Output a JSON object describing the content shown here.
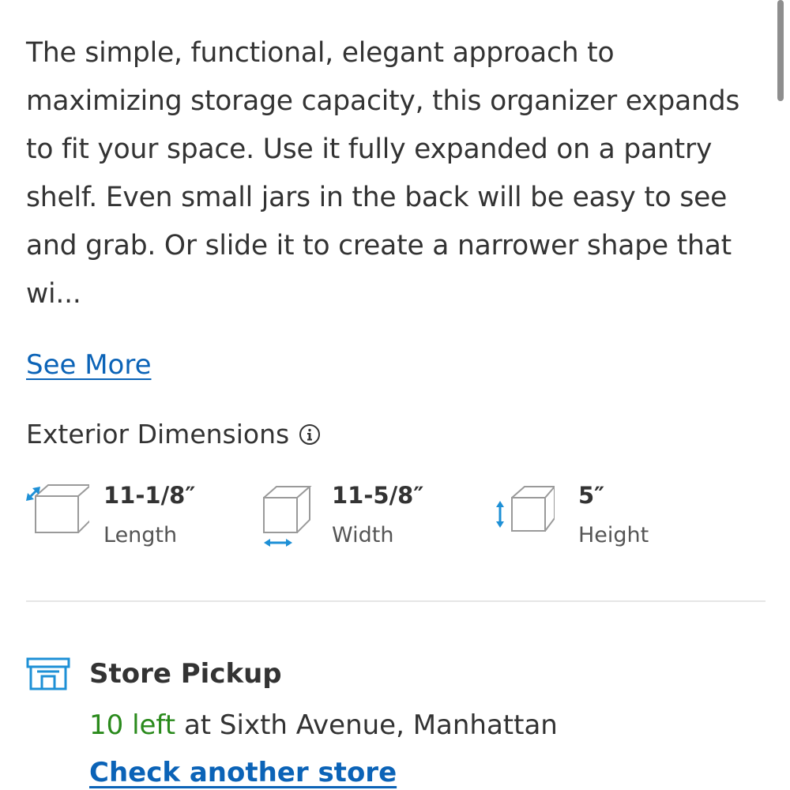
{
  "description": {
    "text": "The simple, functional, elegant approach to maximizing storage capacity, this organizer expands to fit your space. Use it fully expanded on a pantry shelf. Even small jars in the back will be easy to see and grab. Or slide it to create a narrower shape that wi..."
  },
  "see_more": {
    "label": "See More"
  },
  "exterior_dimensions": {
    "heading": "Exterior Dimensions",
    "info_icon": "info-circle-icon",
    "items": [
      {
        "value": "11-1/8″",
        "label": "Length",
        "icon": "length-cube-icon"
      },
      {
        "value": "11-5/8″",
        "label": "Width",
        "icon": "width-cube-icon"
      },
      {
        "value": "5″",
        "label": "Height",
        "icon": "height-cube-icon"
      }
    ]
  },
  "store_pickup": {
    "icon": "store-icon",
    "title": "Store Pickup",
    "count_text": "10 left",
    "location_text": " at Sixth Avenue, Manhattan",
    "check_link": "Check another store"
  },
  "colors": {
    "accent_blue": "#0b63b7",
    "arrow_blue": "#1e90d6",
    "stock_green": "#2a8a1c",
    "text": "#333333"
  }
}
